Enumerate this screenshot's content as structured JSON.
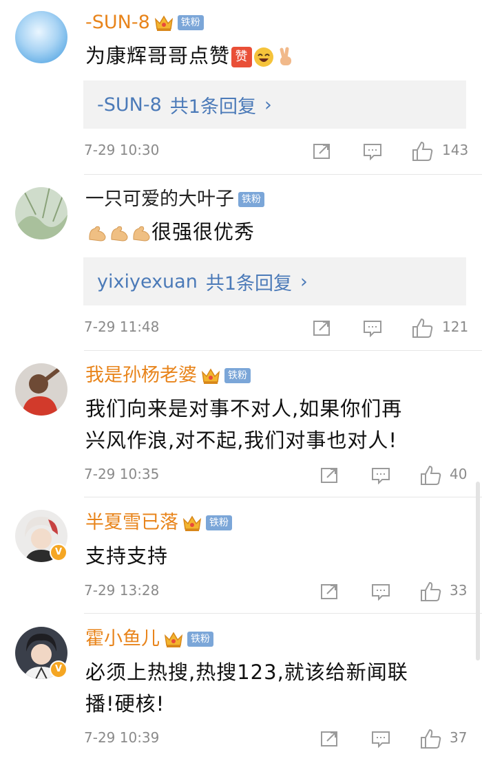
{
  "comments": [
    {
      "username": "-SUN-8",
      "fan_label": "铁粉",
      "text": "为康辉哥哥点赞",
      "reply": {
        "user": "-SUN-8",
        "count": "共1条回复",
        "chevron": "›"
      },
      "time": "7-29 10:30",
      "likes": "143"
    },
    {
      "username": "一只可爱的大叶子",
      "fan_label": "铁粉",
      "text": "很强很优秀",
      "reply": {
        "user": "yixiyexuan",
        "count": "共1条回复",
        "chevron": "›"
      },
      "time": "7-29 11:48",
      "likes": "121"
    },
    {
      "username": "我是孙杨老婆",
      "fan_label": "铁粉",
      "text_line1": "我们向来是对事不对人,如果你们再",
      "text_line2": "兴风作浪,对不起,我们对事也对人!",
      "time": "7-29 10:35",
      "likes": "40"
    },
    {
      "username": "半夏雪已落",
      "fan_label": "铁粉",
      "text": "支持支持",
      "time": "7-29 13:28",
      "likes": "33"
    },
    {
      "username": "霍小鱼儿",
      "fan_label": "铁粉",
      "text_line1": "必须上热搜,热搜123,就该给新闻联",
      "text_line2": "播!硬核!",
      "time": "7-29 10:39",
      "likes": "37"
    }
  ],
  "colors": {
    "username_orange": "#e8841b",
    "fan_badge": "#7ba6d8",
    "reply_link": "#4b7ab8",
    "meta_gray": "#8a8a8a"
  },
  "icons": {
    "crown": "crown-icon",
    "repost": "repost-icon",
    "comment": "comment-icon",
    "like": "thumbs-up-icon",
    "verified": "verified-v-icon"
  },
  "verified_mark": "V",
  "emoji_zan": "赞"
}
